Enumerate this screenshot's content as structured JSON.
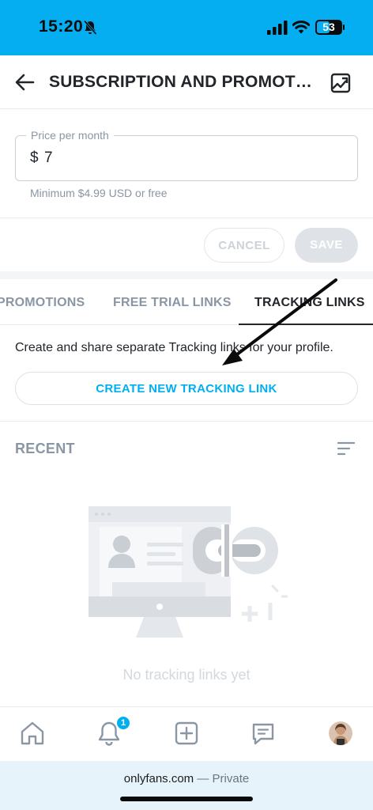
{
  "status_bar": {
    "time": "15:20",
    "battery": "53",
    "battery_level": 0.53,
    "icons": [
      "bell-slash-icon",
      "signal-icon",
      "wifi-icon",
      "battery-icon"
    ]
  },
  "header": {
    "title": "SUBSCRIPTION AND PROMOTIONS",
    "icons": [
      "back-arrow-icon",
      "gallery-icon"
    ]
  },
  "price": {
    "label": "Price per month",
    "currency": "$",
    "value": "7",
    "hint": "Minimum $4.99 USD or free"
  },
  "actions": {
    "cancel": "CANCEL",
    "save": "SAVE"
  },
  "tabs": {
    "promotions": "PROMOTIONS",
    "free_trial": "FREE TRIAL LINKS",
    "tracking": "TRACKING LINKS",
    "active": "TRACKING LINKS"
  },
  "tracking": {
    "description": "Create and share separate Tracking links for your profile.",
    "create_button": "CREATE NEW TRACKING LINK"
  },
  "recent": {
    "title": "RECENT",
    "empty_text": "No tracking links yet"
  },
  "bottom_nav": {
    "notification_count": "1",
    "icons": [
      "home-icon",
      "bell-icon",
      "add-icon",
      "message-icon",
      "avatar"
    ]
  },
  "browser": {
    "domain": "onlyfans.com",
    "separator": " — ",
    "mode": "Private"
  },
  "colors": {
    "brand": "#00aff0",
    "status_bar": "#05aef0",
    "text": "#22262b",
    "muted": "#8a96a3"
  }
}
